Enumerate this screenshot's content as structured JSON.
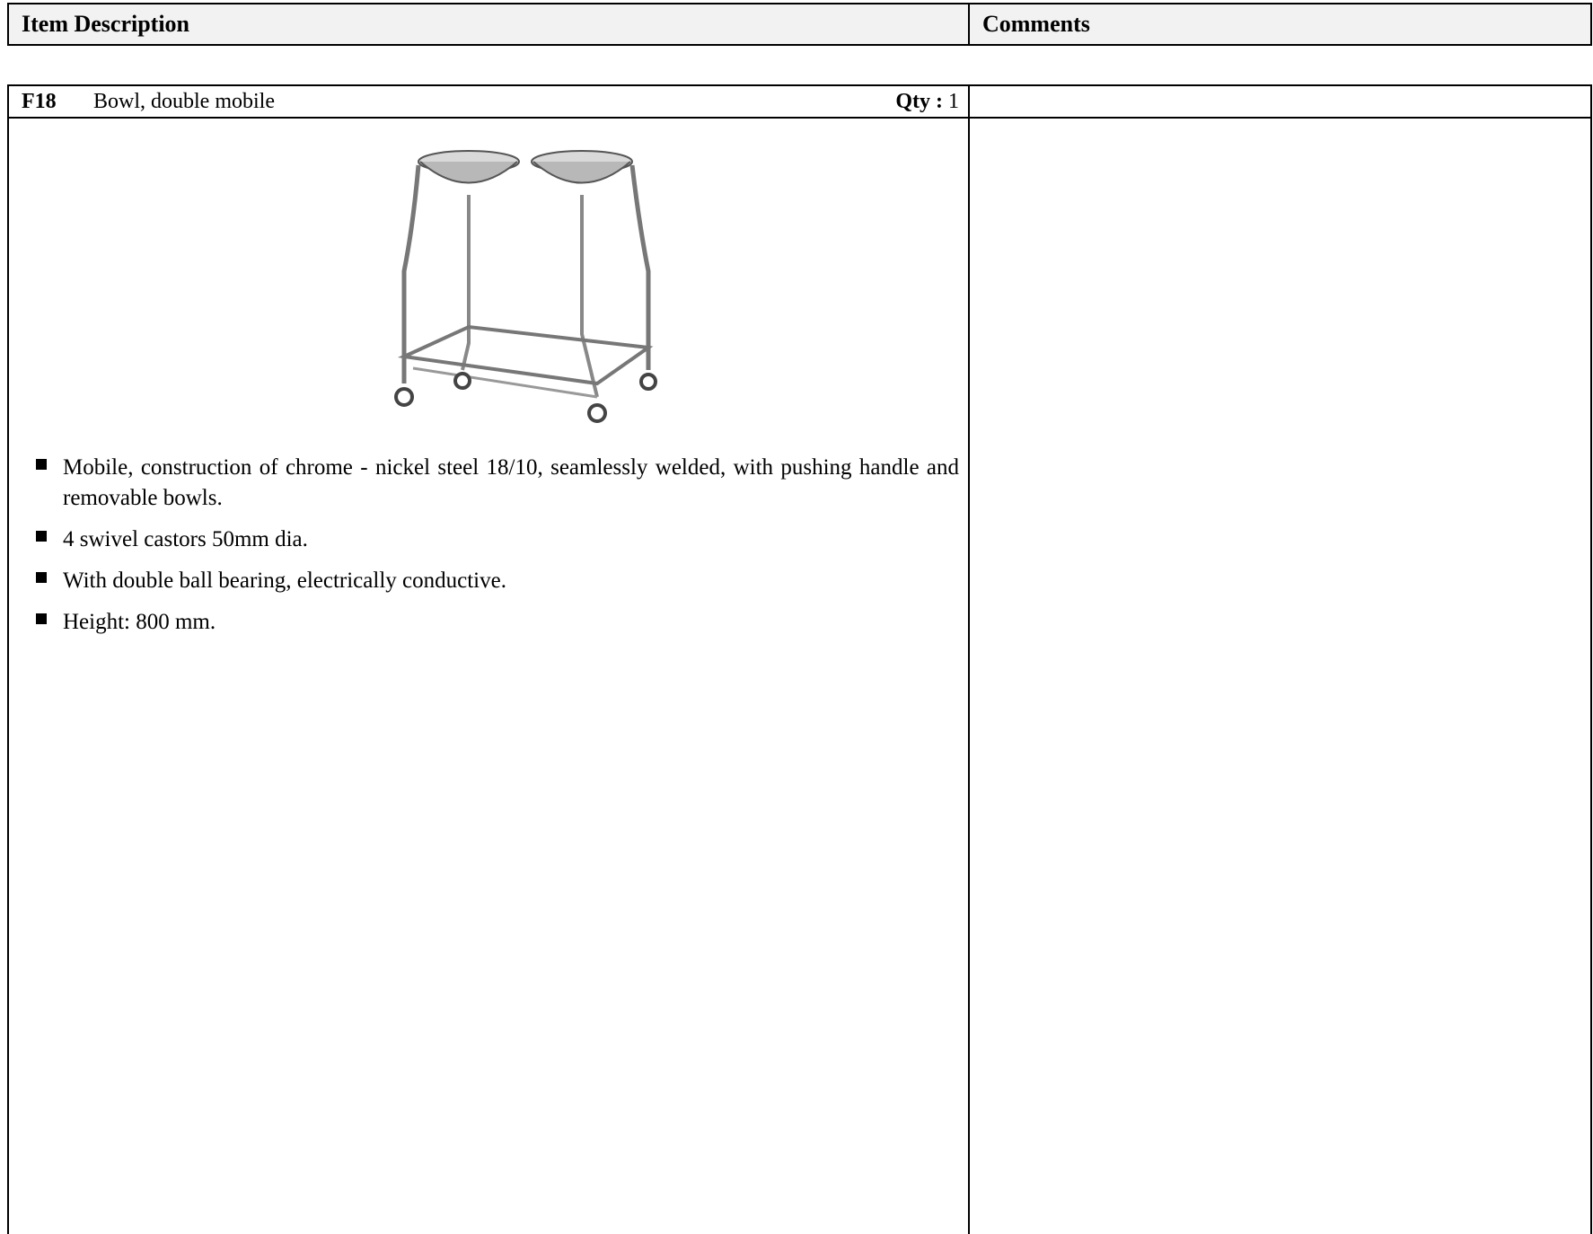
{
  "header": {
    "item_description_label": "Item Description",
    "comments_label": "Comments"
  },
  "item": {
    "code": "F18",
    "name": "Bowl, double mobile",
    "qty_label": "Qty :",
    "qty": "1",
    "image_icon": "double-bowl-stand-icon",
    "specs": [
      "Mobile, construction of chrome - nickel steel 18/10, seamlessly welded, with pushing handle and removable bowls.",
      "4 swivel castors 50mm dia.",
      "With double ball bearing, electrically conductive.",
      "Height: 800 mm."
    ],
    "comments": ""
  }
}
